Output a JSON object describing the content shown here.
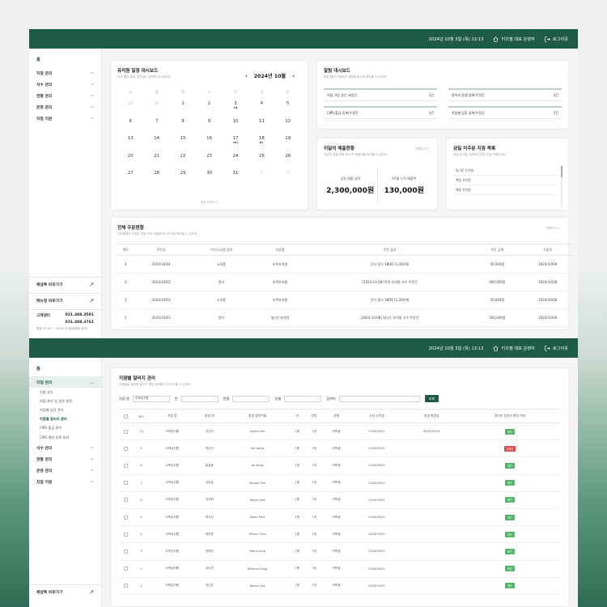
{
  "topbar": {
    "datetime": "2024년 10월 3일 (목) 13:13",
    "user": "키즈필 대표 운영자",
    "logout": "로그아웃"
  },
  "sidebar1": {
    "home": "홈",
    "menus": [
      "지점 관리",
      "식수 관리",
      "현황 관리",
      "운영 관리",
      "지점 지원"
    ],
    "shortcut_channel": "채널톡 바로가기",
    "shortcut_manual": "매뉴얼 바로가기",
    "cs_label": "고객센터",
    "cs_phone1": "031.388.3501",
    "cs_phone2": "031.388.3761",
    "cs_hours": "평일 07:30 ~ 16:30 (주말/공휴일 휴무)"
  },
  "calendar": {
    "title": "유치원 일정 대시보드",
    "subtitle": "금주 월간 일정, 휴무일이 달력에 표시됩니다",
    "month": "2024년 10월",
    "weekdays": [
      "일",
      "월",
      "화",
      "수",
      "목",
      "금",
      "토"
    ],
    "weeks": [
      [
        "29",
        "30",
        "1",
        "2",
        "3",
        "4",
        "5"
      ],
      [
        "6",
        "7",
        "8",
        "9",
        "10",
        "11",
        "12"
      ],
      [
        "13",
        "14",
        "15",
        "16",
        "17",
        "18",
        "19"
      ],
      [
        "20",
        "21",
        "22",
        "23",
        "24",
        "25",
        "26"
      ],
      [
        "27",
        "28",
        "29",
        "30",
        "31",
        "1",
        "2"
      ]
    ],
    "note": "일정 전체보기"
  },
  "alerts": {
    "title": "알림 대시보드",
    "subtitle": "알림 확인이 필요한 내용을 한눈에 확인할 수 있어요",
    "items": [
      {
        "label": "지점 가입 승인 요청건",
        "count": "1건"
      },
      {
        "label": "알러지 원생 등록/수정건",
        "count": "3건"
      },
      {
        "label": "CMS 출금 등록/수정건",
        "count": "1건"
      },
      {
        "label": "지점별 담당 등록/수정건",
        "count": "1건"
      }
    ]
  },
  "sales": {
    "title": "이달의 매출현황",
    "subtitle": "이달의 매출 현황 및 누적 매출액을 확인할 수 있어요",
    "more": "전체보기 >",
    "monthly_label": "금일 매출 금액",
    "monthly_value": "2,300,000원",
    "cumulative_label": "10월 누적 매출액",
    "cumulative_value": "130,000원"
  },
  "unregistered": {
    "title": "금일 미주문 지점 목록",
    "subtitle": "금일 급식을 주문하지 않은 지점 목록이에요",
    "items": [
      "빛나던 유치원",
      "햇살 유치원",
      "해봄 유치원"
    ]
  },
  "orders": {
    "title": "전체 주문현황",
    "subtitle": "유치원에서 주문한 전체 주문 내용을 최신순으로 확인할 수 있어요",
    "more": "전체보기 >",
    "headers": [
      "NO.",
      "주문일",
      "식수/소모품 옵션",
      "지점명",
      "주문 옵션",
      "주문 금액",
      "지점일"
    ],
    "rows": [
      [
        "4",
        "2024/10/04",
        "소모품",
        "조목유치원",
        "간식 정식 1BOX (1,200개)",
        "50,000원",
        "2024/10/09"
      ],
      [
        "3",
        "2024/10/03",
        "정식",
        "조목유치원",
        "[2024-10-08] 토목 유치원 식수 주문건",
        "660,000원",
        "2024/10/08"
      ],
      [
        "2",
        "2024/10/03",
        "소모품",
        "조목유치원",
        "간식 정식 1BOX (1,200개)",
        "50,000원",
        "2024/10/08"
      ],
      [
        "1",
        "2024/10/03",
        "정식",
        "빛나는유치원",
        "[2024-10-08] 빛나는 유치원 식수 주문건",
        "500,000원",
        "2024/10/08"
      ]
    ]
  },
  "sidebar2": {
    "home": "홈",
    "active_menu": "지점 관리",
    "subs": [
      "지점 승인",
      "지점 관리 및 권한 설정",
      "지점별 담당 관리",
      "지점별 알러지 관리",
      "CMS 출금 관리",
      "CMS 계좌 등록 관리"
    ],
    "menus": [
      "식수 관리",
      "현황 관리",
      "운영 관리",
      "지점 지원"
    ],
    "shortcut_channel": "채널톡 바로가기"
  },
  "letters": {
    "title": "지점별 알러지 관리",
    "subtitle": "지점별로 등록한 알러지 원생 정보를 보고 관리할 수 있어요",
    "filters": {
      "branch_label": "지점 명",
      "branch_value": "조목유치원",
      "class_label": "반",
      "age_label": "연령",
      "gender_label": "성별",
      "keyword_label": "검색어",
      "search_btn": "조회"
    },
    "headers": [
      "NO.",
      "지점 명",
      "원생 명",
      "원생 영문이름",
      "반",
      "연령",
      "성별",
      "식사 시작일",
      "원생 퇴원일",
      "알러지 동일지 확인 여부"
    ],
    "rows": [
      [
        "10",
        "조목유치원",
        "이주연",
        "Juyeon lee",
        "1층",
        "7세",
        "여학생",
        "2024/03/01",
        "2023/10/10",
        "확인"
      ],
      [
        "9",
        "조목유치원",
        "최은석",
        "Jisi wang",
        "1층",
        "7세",
        "여학생",
        "2024/03/01",
        "",
        "미확인"
      ],
      [
        "8",
        "조목유치원",
        "홍길동",
        "gil dong",
        "1층",
        "7세",
        "여학생",
        "2024/03/01",
        "",
        "확인"
      ],
      [
        "7",
        "조목유치원",
        "김하늘",
        "Haneul Kim",
        "1층",
        "7세",
        "여학생",
        "2024/03/01",
        "",
        "확인"
      ],
      [
        "6",
        "조목유치원",
        "이지원",
        "Jihoon Lee",
        "1층",
        "7세",
        "여학생",
        "2024/03/01",
        "",
        "확인"
      ],
      [
        "5",
        "조목유치원",
        "박고인",
        "Sabin Park",
        "1층",
        "7세",
        "여학생",
        "2024/03/01",
        "",
        "확인"
      ],
      [
        "4",
        "조목유치원",
        "최민준",
        "Minjun Choi",
        "1층",
        "7세",
        "여학생",
        "2024/03/01",
        "",
        "확인"
      ],
      [
        "3",
        "조목유치원",
        "정예진",
        "Yeeun Jung",
        "1층",
        "7세",
        "여학생",
        "2024/03/01",
        "",
        "확인"
      ],
      [
        "2",
        "조목유치원",
        "강다연",
        "DaHyun Kang",
        "1층",
        "7세",
        "여학생",
        "2024/03/01",
        "",
        "확인"
      ],
      [
        "1",
        "조목유치원",
        "이나은",
        "Naeun Lee",
        "1층",
        "7세",
        "여학생",
        "2024/03/01",
        "",
        "확인"
      ]
    ]
  },
  "colors": {
    "brand": "#1d5a47",
    "ok": "#52b36a",
    "no": "#e04a4a"
  },
  "icons": [
    "home-icon",
    "logout-icon",
    "chevron-down-icon",
    "chevron-up-icon",
    "chevron-left-icon",
    "chevron-right-icon",
    "external-arrow-icon"
  ]
}
